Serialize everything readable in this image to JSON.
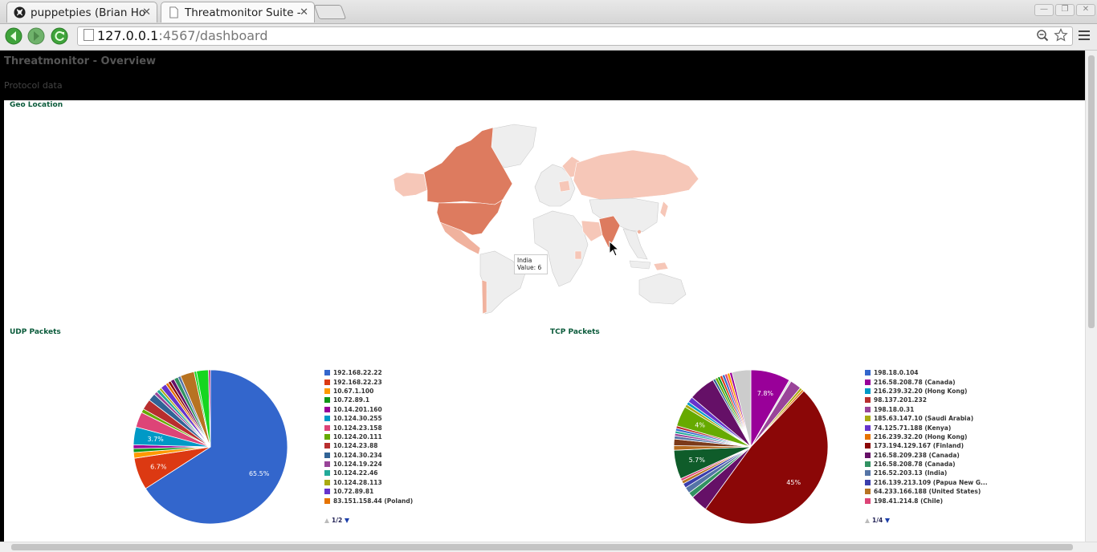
{
  "browser": {
    "tabs": [
      {
        "label": "puppetpies (Brian Ho",
        "icon": "github-icon"
      },
      {
        "label": "Threatmonitor Suite -",
        "icon": "page-icon"
      }
    ],
    "url_host": "127.0.0.1",
    "url_rest": ":4567/dashboard"
  },
  "header": {
    "title": "Threatmonitor - Overview",
    "nav_link": "Protocol data"
  },
  "geo": {
    "title": "Geo Location",
    "highlight_colors": {
      "high": "#dd7b5f",
      "mid": "#f0b29e",
      "low": "#f6c7b8",
      "none": "#eeeeee"
    },
    "tooltip": {
      "country": "India",
      "value_label": "Value:",
      "value": "6"
    }
  },
  "udp": {
    "title": "UDP Packets",
    "legend": [
      {
        "label": "192.168.22.22",
        "color": "#3366cc"
      },
      {
        "label": "192.168.22.23",
        "color": "#dc3912"
      },
      {
        "label": "10.67.1.100",
        "color": "#ff9900"
      },
      {
        "label": "10.72.89.1",
        "color": "#109618"
      },
      {
        "label": "10.14.201.160",
        "color": "#990099"
      },
      {
        "label": "10.124.30.255",
        "color": "#0099c6"
      },
      {
        "label": "10.124.23.158",
        "color": "#dd4477"
      },
      {
        "label": "10.124.20.111",
        "color": "#66aa00"
      },
      {
        "label": "10.124.23.88",
        "color": "#b82e2e"
      },
      {
        "label": "10.124.30.234",
        "color": "#316395"
      },
      {
        "label": "10.124.19.224",
        "color": "#994499"
      },
      {
        "label": "10.124.22.46",
        "color": "#22aa99"
      },
      {
        "label": "10.124.28.113",
        "color": "#aaaa11"
      },
      {
        "label": "10.72.89.81",
        "color": "#6633cc"
      },
      {
        "label": "83.151.158.44 (Poland)",
        "color": "#e67300"
      }
    ],
    "page": "1/2",
    "slices": [
      {
        "value": 65.5,
        "color": "#3366cc",
        "label": "65.5%"
      },
      {
        "value": 6.7,
        "color": "#dc3912",
        "label": "6.7%"
      },
      {
        "value": 1.2,
        "color": "#ff9900",
        "label": ""
      },
      {
        "value": 0.8,
        "color": "#109618",
        "label": ""
      },
      {
        "value": 0.8,
        "color": "#990099",
        "label": ""
      },
      {
        "value": 3.7,
        "color": "#0099c6",
        "label": "3.7%"
      },
      {
        "value": 3.2,
        "color": "#dd4477",
        "label": ""
      },
      {
        "value": 0.8,
        "color": "#66aa00",
        "label": ""
      },
      {
        "value": 2.2,
        "color": "#b82e2e",
        "label": ""
      },
      {
        "value": 1.6,
        "color": "#316395",
        "label": ""
      },
      {
        "value": 0.7,
        "color": "#994499",
        "label": ""
      },
      {
        "value": 0.7,
        "color": "#22aa99",
        "label": ""
      },
      {
        "value": 0.5,
        "color": "#aaaa11",
        "label": ""
      },
      {
        "value": 1.2,
        "color": "#6633cc",
        "label": ""
      },
      {
        "value": 0.6,
        "color": "#e67300",
        "label": ""
      },
      {
        "value": 0.6,
        "color": "#8b0707",
        "label": ""
      },
      {
        "value": 0.8,
        "color": "#651067",
        "label": ""
      },
      {
        "value": 0.9,
        "color": "#329262",
        "label": ""
      },
      {
        "value": 0.6,
        "color": "#5574a6",
        "label": ""
      },
      {
        "value": 2.9,
        "color": "#b77322",
        "label": ""
      },
      {
        "value": 0.5,
        "color": "#16d620",
        "label": ""
      },
      {
        "value": 2.5,
        "color": "#16d620",
        "label": ""
      },
      {
        "value": 0.4,
        "color": "#b91383",
        "label": ""
      }
    ]
  },
  "tcp": {
    "title": "TCP Packets",
    "legend": [
      {
        "label": "198.18.0.104",
        "color": "#3366cc"
      },
      {
        "label": "216.58.208.78 (Canada)",
        "color": "#990099"
      },
      {
        "label": "216.239.32.20 (Hong Kong)",
        "color": "#0099c6"
      },
      {
        "label": "98.137.201.232",
        "color": "#b82e2e"
      },
      {
        "label": "198.18.0.31",
        "color": "#994499"
      },
      {
        "label": "185.63.147.10 (Saudi Arabia)",
        "color": "#aaaa11"
      },
      {
        "label": "74.125.71.188 (Kenya)",
        "color": "#6633cc"
      },
      {
        "label": "216.239.32.20 (Hong Kong)",
        "color": "#e67300"
      },
      {
        "label": "173.194.129.167 (Finland)",
        "color": "#8b0707"
      },
      {
        "label": "216.58.209.238 (Canada)",
        "color": "#651067"
      },
      {
        "label": "216.58.208.78 (Canada)",
        "color": "#329262"
      },
      {
        "label": "216.52.203.13 (India)",
        "color": "#5574a6"
      },
      {
        "label": "216.139.213.109 (Papua New G...",
        "color": "#3b3eac"
      },
      {
        "label": "64.233.166.188 (United States)",
        "color": "#b77322"
      },
      {
        "label": "198.41.214.8 (Chile)",
        "color": "#dd4477"
      }
    ],
    "page": "1/4",
    "slices": [
      {
        "value": 7.8,
        "color": "#990099",
        "label": "7.8%"
      },
      {
        "value": 0.4,
        "color": "#dddddd",
        "label": ""
      },
      {
        "value": 2.2,
        "color": "#994499",
        "label": ""
      },
      {
        "value": 0.5,
        "color": "#aaaa11",
        "label": ""
      },
      {
        "value": 0.4,
        "color": "#e67300",
        "label": ""
      },
      {
        "value": 45,
        "color": "#8b0707",
        "label": "45%"
      },
      {
        "value": 3.4,
        "color": "#651067",
        "label": ""
      },
      {
        "value": 1.1,
        "color": "#329262",
        "label": ""
      },
      {
        "value": 1.2,
        "color": "#5574a6",
        "label": ""
      },
      {
        "value": 0.9,
        "color": "#3b3eac",
        "label": ""
      },
      {
        "value": 0.6,
        "color": "#b77322",
        "label": ""
      },
      {
        "value": 0.5,
        "color": "#dd4477",
        "label": ""
      },
      {
        "value": 5.7,
        "color": "#0f5c2a",
        "label": "5.7%"
      },
      {
        "value": 0.9,
        "color": "#b56a1f",
        "label": ""
      },
      {
        "value": 1.3,
        "color": "#7b3a1a",
        "label": ""
      },
      {
        "value": 0.6,
        "color": "#5574a6",
        "label": ""
      },
      {
        "value": 0.5,
        "color": "#994499",
        "label": ""
      },
      {
        "value": 0.5,
        "color": "#22aa99",
        "label": ""
      },
      {
        "value": 0.5,
        "color": "#3366cc",
        "label": ""
      },
      {
        "value": 0.5,
        "color": "#b82e2e",
        "label": ""
      },
      {
        "value": 4,
        "color": "#66aa00",
        "label": "4%"
      },
      {
        "value": 0.6,
        "color": "#aaaa11",
        "label": ""
      },
      {
        "value": 0.6,
        "color": "#0099c6",
        "label": ""
      },
      {
        "value": 1.1,
        "color": "#6633cc",
        "label": ""
      },
      {
        "value": 5.3,
        "color": "#651067",
        "label": ""
      },
      {
        "value": 0.5,
        "color": "#316395",
        "label": ""
      },
      {
        "value": 0.5,
        "color": "#66aa00",
        "label": ""
      },
      {
        "value": 0.5,
        "color": "#109618",
        "label": ""
      },
      {
        "value": 0.5,
        "color": "#dc3912",
        "label": ""
      },
      {
        "value": 0.5,
        "color": "#3366cc",
        "label": ""
      },
      {
        "value": 0.5,
        "color": "#dd4477",
        "label": ""
      },
      {
        "value": 0.5,
        "color": "#ff9900",
        "label": ""
      },
      {
        "value": 0.5,
        "color": "#990099",
        "label": ""
      },
      {
        "value": 3.7,
        "color": "#cccccc",
        "label": ""
      }
    ]
  }
}
